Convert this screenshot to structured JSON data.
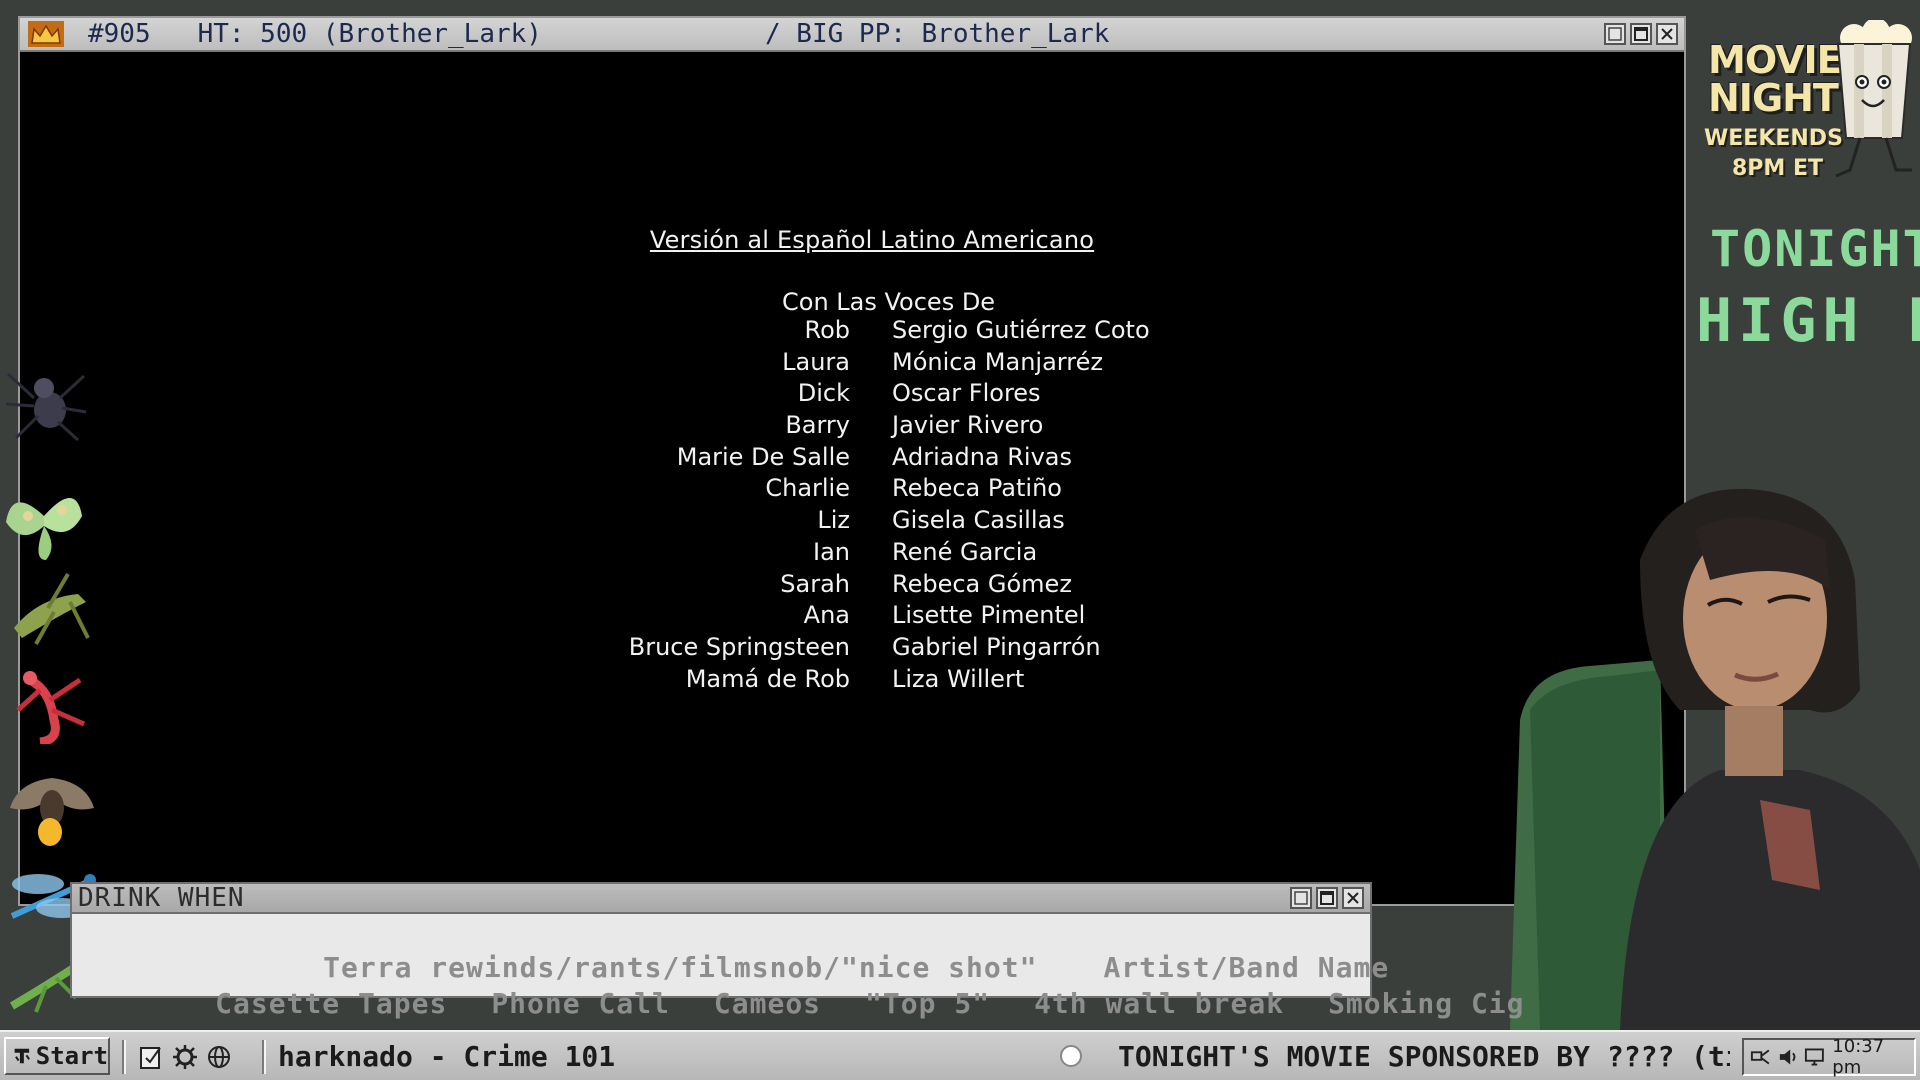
{
  "movie_window": {
    "title_left": "#905   HT: 500 (Brother_Lark)",
    "title_right": "/ BIG PP: Brother_Lark"
  },
  "credits": {
    "heading": "Versión al Español Latino Americano",
    "subheading": "Con Las Voces De",
    "cast": [
      {
        "role": "Rob",
        "actor": "Sergio Gutiérrez Coto"
      },
      {
        "role": "Laura",
        "actor": "Mónica Manjarréz"
      },
      {
        "role": "Dick",
        "actor": "Oscar Flores"
      },
      {
        "role": "Barry",
        "actor": "Javier Rivero"
      },
      {
        "role": "Marie De Salle",
        "actor": "Adriadna Rivas"
      },
      {
        "role": "Charlie",
        "actor": "Rebeca Patiño"
      },
      {
        "role": "Liz",
        "actor": "Gisela Casillas"
      },
      {
        "role": "Ian",
        "actor": "René Garcia"
      },
      {
        "role": "Sarah",
        "actor": "Rebeca Gómez"
      },
      {
        "role": "Ana",
        "actor": "Lisette Pimentel"
      },
      {
        "role": "Bruce Springsteen",
        "actor": "Gabriel Pingarrón"
      },
      {
        "role": "Mamá de Rob",
        "actor": "Liza Willert"
      }
    ]
  },
  "sidebar_panel": {
    "logo_movie": "MOVIE",
    "logo_night": "NIGHT",
    "logo_weekends": "WEEKENDS",
    "logo_time": "8PM ET",
    "tonight_label": "TONIGHT:",
    "tonight_title": "HIGH FID"
  },
  "drink_when": {
    "title": "DRINK WHEN",
    "row1": [
      "Terra rewinds/rants/filmsnob/\"nice shot\"",
      "Artist/Band Name"
    ],
    "row2": [
      "Casette Tapes",
      "Phone Call",
      "Cameos",
      "\"Top 5\"",
      "4th wall break",
      "Smoking Cig"
    ]
  },
  "taskbar": {
    "start_label": "Start",
    "task_title": "harknado - Crime 101",
    "ticker": "TONIGHT'S MOVIE SPONSORED BY ???? (ti",
    "clock": "10:37 pm"
  },
  "colors": {
    "credits_text": "#f2f2f2",
    "titlebar_text": "#1d2a4e",
    "tonight_green": "#8bd99b",
    "logo_cream": "#f3e6a8",
    "drink_text": "#8d8d8d"
  },
  "icons": [
    "crown-icon",
    "popcorn-icon",
    "spider-icon",
    "moth-icon",
    "grasshopper-icon",
    "mantis-icon",
    "firefly-icon",
    "dragonfly-icon",
    "start-icon",
    "notepad-icon",
    "gear-icon",
    "globe-icon",
    "record-icon",
    "network-icon",
    "speaker-icon",
    "monitor-icon"
  ]
}
